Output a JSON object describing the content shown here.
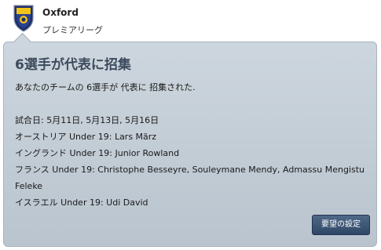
{
  "header": {
    "club_name": "Oxford",
    "league_name": "プレミアリーグ",
    "crest_icon": "club-crest-icon"
  },
  "card": {
    "title": "6選手が代表に招集",
    "summary": "あなたのチームの 6選手が 代表に 招集された.",
    "match_dates": "試合日:  5月11日, 5月13日, 5月16日",
    "callups": [
      "オーストリア Under 19: Lars März",
      "イングランド Under 19: Junior Rowland",
      "フランス Under 19: Christophe Besseyre, Souleymane Mendy, Admassu Mengistu Feleke",
      "イスラエル Under 19: Udi David"
    ],
    "button_label": "要望の設定"
  },
  "colors": {
    "card_background": "#c3cdd6",
    "title": "#3c4a5c",
    "button": "#3a5373"
  }
}
